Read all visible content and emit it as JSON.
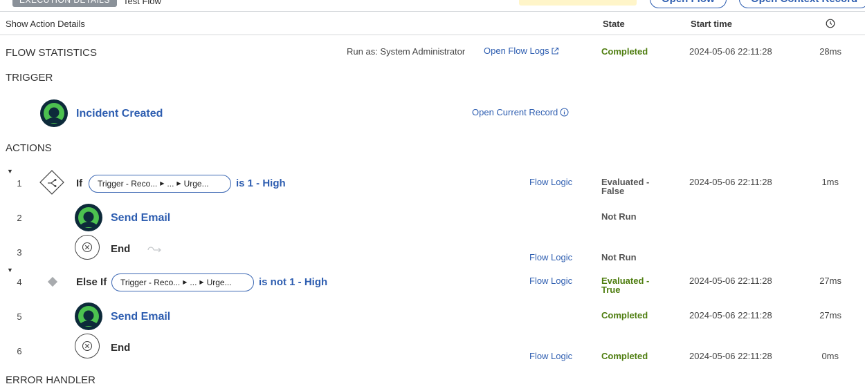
{
  "top": {
    "execution_tab": "EXECUTION DETAILS",
    "flow_name": "Test Flow",
    "open_flow": "Open Flow",
    "open_context": "Open Context Record"
  },
  "header": {
    "show_action_details": "Show Action Details",
    "state": "State",
    "start_time": "Start time"
  },
  "flow_statistics": {
    "title": "FLOW STATISTICS",
    "run_as": "Run as: System Administrator",
    "open_logs": "Open Flow Logs",
    "state": "Completed",
    "start_time": "2024-05-06 22:11:28",
    "duration": "28ms"
  },
  "trigger": {
    "title": "TRIGGER",
    "name": "Incident Created",
    "open_record": "Open Current Record"
  },
  "actions_title": "ACTIONS",
  "actions": [
    {
      "num": "1",
      "kw": "If",
      "pill": [
        "Trigger - Reco...",
        "...",
        "Urge..."
      ],
      "cond": "is 1 - High",
      "logic": "Flow Logic",
      "state": [
        "Evaluated -",
        "False"
      ],
      "time": "2024-05-06 22:11:28",
      "dur": "1ms"
    },
    {
      "num": "2",
      "name": "Send Email",
      "state": "Not Run"
    },
    {
      "num": "3",
      "name": "End",
      "logic": "Flow Logic",
      "state": "Not Run"
    },
    {
      "num": "4",
      "kw": "Else If",
      "pill": [
        "Trigger - Reco...",
        "...",
        "Urge..."
      ],
      "cond": "is not 1 - High",
      "logic": "Flow Logic",
      "state": [
        "Evaluated -",
        "True"
      ],
      "time": "2024-05-06 22:11:28",
      "dur": "27ms"
    },
    {
      "num": "5",
      "name": "Send Email",
      "state": "Completed",
      "time": "2024-05-06 22:11:28",
      "dur": "27ms"
    },
    {
      "num": "6",
      "name": "End",
      "logic": "Flow Logic",
      "state": "Completed",
      "time": "2024-05-06 22:11:28",
      "dur": "0ms"
    }
  ],
  "error_handler": "ERROR HANDLER",
  "colors": {
    "link": "#2d5db0",
    "completed": "#4e7d0f",
    "avatar_ring": "#4cc14f"
  }
}
